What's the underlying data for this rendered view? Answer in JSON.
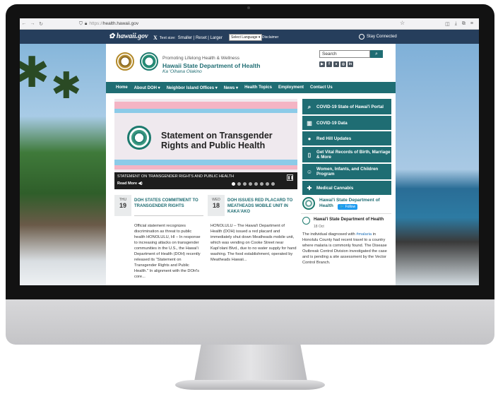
{
  "browser": {
    "url_prefix": "https://",
    "url_host": "health.hawaii.gov"
  },
  "govbar": {
    "logo": "hawaii.gov",
    "text_size_label": "Text size:",
    "text_size_options": "Smaller | Reset | Larger",
    "language_select": "Select Language",
    "disclaimer": "Disclaimer",
    "stay_connected": "Stay Connected"
  },
  "header": {
    "tagline": "Promoting Lifelong Health & Wellness",
    "department": "Hawaii State Department of Health",
    "hawaiian_name": "Ka 'Oihana Olakino",
    "search_placeholder": "Search"
  },
  "nav": {
    "items": [
      "Home",
      "About DOH ▾",
      "Neighbor Island Offices ▾",
      "News ▾",
      "Health Topics",
      "Employment",
      "Contact Us"
    ]
  },
  "slider": {
    "title": "Statement on Transgender Rights and Public Health",
    "caption": "STATEMENT ON TRANSGENDER RIGHTS AND PUBLIC HEALTH",
    "read_more": "Read More ◀)"
  },
  "quick_links": [
    {
      "label": "COVID-19 State of Hawai'i Portal",
      "icon": "search-icon"
    },
    {
      "label": "COVID-19 Data",
      "icon": "bar-chart-icon"
    },
    {
      "label": "Red Hill Updates",
      "icon": "droplet-icon"
    },
    {
      "label": "Get Vital Records of Birth, Marriage & More",
      "icon": "document-icon"
    },
    {
      "label": "Women, Infants, and Children Program",
      "icon": "family-icon"
    },
    {
      "label": "Medical Cannabis",
      "icon": "medical-kit-icon"
    }
  ],
  "news": [
    {
      "dow": "THU",
      "day": "19",
      "title": "DOH STATES COMMITMENT TO TRANSGENDER RIGHTS",
      "body": "Official statement recognizes discrimination as threat to public health  HONOLULU, HI – In response to increasing attacks on transgender communities in the U.S., the Hawai'i Department of Health (DOH) recently released its \"Statement on Transgender Rights and Public Health.\" In alignment with the DOH's core..."
    },
    {
      "dow": "WED",
      "day": "18",
      "title": "DOH ISSUES RED PLACARD TO MEATHEADS MOBILE UNIT IN KAKA'AKO",
      "body": "HONOLULU – The Hawai'i Department of Health (DOH) issued a red placard and immediately shut down Meatheads mobile unit, which was vending on Cooke Street near Kapi'olani Blvd., due to no water supply for hand washing. The food establishment, operated by Meatheads Hawaii..."
    }
  ],
  "twitter": {
    "account": "Hawai'i State Department of Health",
    "follow": "🐦 Follow",
    "author": "Hawai'i State Department of Health",
    "date": "18 Oct",
    "text_before": "The individual diagnosed with ",
    "hashtag": "#malaria",
    "text_after": " in Honolulu County had recent travel to a country where malaria is commonly found. The Disease Outbreak Control Division investigated the case and is pending a site assessment by the Vector Control Branch."
  },
  "colors": {
    "teal": "#1f6d73",
    "govbar": "#263e5c"
  }
}
